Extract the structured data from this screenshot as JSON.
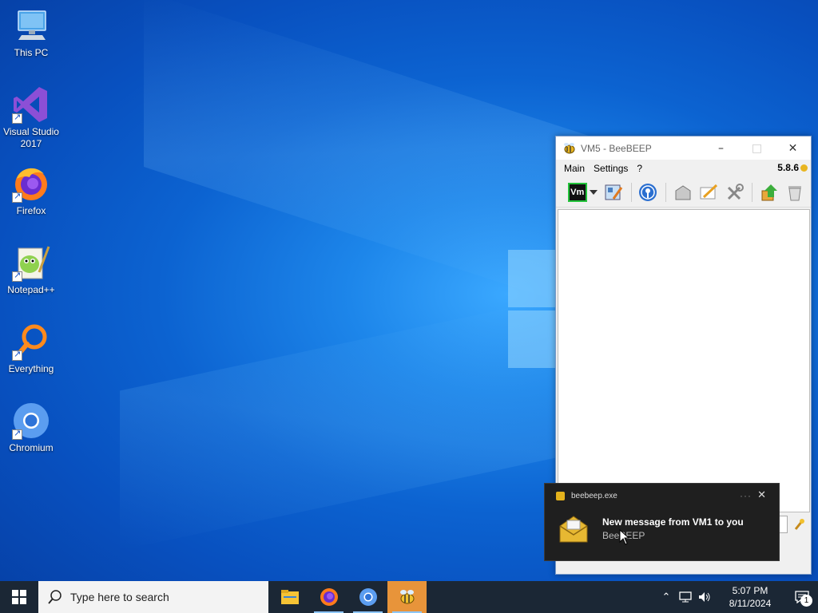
{
  "desktop": {
    "icons": [
      {
        "label": "This PC",
        "icon": "computer-icon"
      },
      {
        "label": "Visual Studio 2017",
        "icon": "visual-studio-icon"
      },
      {
        "label": "Firefox",
        "icon": "firefox-icon"
      },
      {
        "label": "Notepad++",
        "icon": "notepad-plus-plus-icon"
      },
      {
        "label": "Everything",
        "icon": "everything-search-icon"
      },
      {
        "label": "Chromium",
        "icon": "chromium-icon"
      }
    ]
  },
  "app_window": {
    "title": "VM5 - BeeBEEP",
    "menu": [
      "Main",
      "Settings",
      "?"
    ],
    "version": "5.8.6",
    "toolbar_icons": [
      "vm-status-icon",
      "dropdown-arrow-icon",
      "edit-profile-icon",
      "network-icon",
      "save-chat-icon",
      "write-message-icon",
      "tools-icon",
      "download-icon",
      "clear-chat-icon"
    ]
  },
  "toast": {
    "app_name": "beebeep.exe",
    "title": "New message from VM1 to you",
    "subtitle": "BeeBEEP"
  },
  "taskbar": {
    "search_placeholder": "Type here to search",
    "apps": [
      "file-explorer-icon",
      "firefox-icon",
      "chromium-icon",
      "beebeep-icon"
    ],
    "clock_time": "5:07 PM",
    "clock_date": "8/11/2024",
    "notification_count": "1"
  },
  "colors": {
    "taskbar_bg": "#1b2735",
    "active_app": "#e8943a",
    "toast_bg": "#1f1f1f"
  }
}
